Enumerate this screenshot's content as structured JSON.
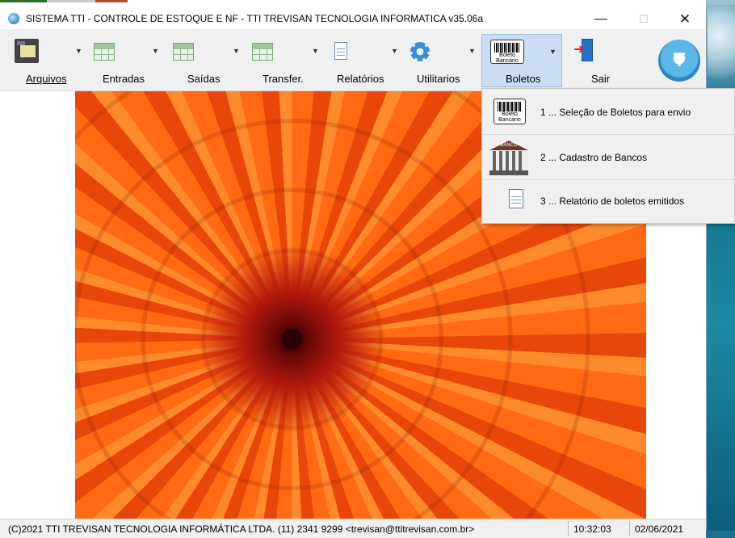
{
  "window": {
    "title": "SISTEMA TTI - CONTROLE DE ESTOQUE E NF - TTI TREVISAN TECNOLOGIA INFORMATICA  v35.06a",
    "minimize": "—",
    "maximize": "☐",
    "close": "✕"
  },
  "toolbar": {
    "items": [
      {
        "label": "Arquivos",
        "icon": "file-cabinet-icon"
      },
      {
        "label": "Entradas",
        "icon": "grid-icon"
      },
      {
        "label": "Saídas",
        "icon": "grid-icon"
      },
      {
        "label": "Transfer.",
        "icon": "grid-icon"
      },
      {
        "label": "Relatórios",
        "icon": "document-icon"
      },
      {
        "label": "Utilitarios",
        "icon": "gear-icon"
      },
      {
        "label": "Boletos",
        "icon": "barcode-icon",
        "selected": true
      },
      {
        "label": "Sair",
        "icon": "exit-door-icon"
      }
    ],
    "arrow": "▼",
    "barcode_text": "Boleto Bancário",
    "logo_glyph": "T"
  },
  "boletos_menu": {
    "items": [
      {
        "label": "1 ... Seleção de Boletos para envio",
        "icon": "barcode-icon"
      },
      {
        "label": "2 ... Cadastro de Bancos",
        "icon": "bank-icon"
      },
      {
        "label": "3 ... Relatório de boletos emitidos",
        "icon": "document-icon"
      }
    ],
    "bank_icon_text": "BANCO"
  },
  "status": {
    "copyright": "(C)2021 TTI TREVISAN TECNOLOGIA INFORMÁTICA LTDA. (11) 2341 9299 <trevisan@ttitrevisan.com.br>",
    "time": "10:32:03",
    "date": "02/06/2021"
  },
  "colors": {
    "selected_bg": "#c9def5",
    "flower": "#f05a0e"
  }
}
